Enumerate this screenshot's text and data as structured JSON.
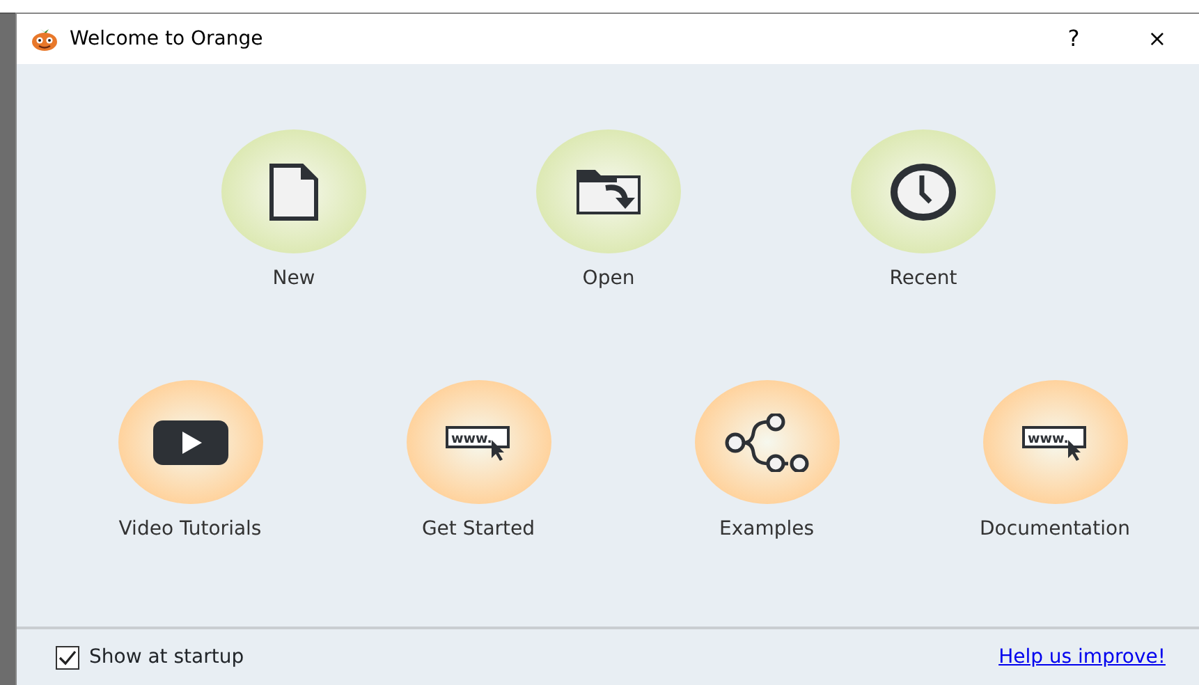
{
  "window": {
    "title": "Welcome to Orange",
    "help": "?",
    "close": "×"
  },
  "top_actions": [
    {
      "label": "New",
      "kind": "file",
      "color": "#dde9b4"
    },
    {
      "label": "Open",
      "kind": "folder",
      "color": "#dde9b4"
    },
    {
      "label": "Recent",
      "kind": "clock",
      "color": "#dde9b4"
    }
  ],
  "bottom_actions": [
    {
      "label": "Video Tutorials",
      "kind": "video",
      "color": "#ffd39e"
    },
    {
      "label": "Get Started",
      "kind": "www",
      "icon_text": "www.",
      "color": "#ffd39e"
    },
    {
      "label": "Examples",
      "kind": "graph",
      "color": "#ffd39e"
    },
    {
      "label": "Documentation",
      "kind": "www",
      "icon_text": "www.",
      "color": "#ffd39e"
    }
  ],
  "footer": {
    "show_at_startup": {
      "label": "Show at startup",
      "checked": true
    },
    "link": "Help us improve!"
  }
}
